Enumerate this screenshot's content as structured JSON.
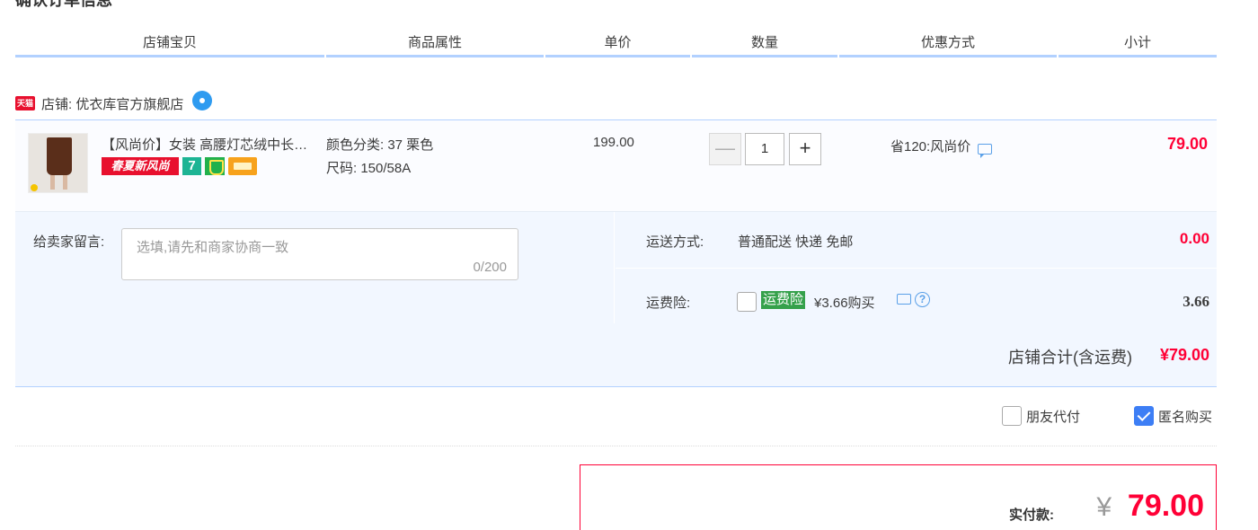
{
  "section_title": "确认订单信息",
  "headers": [
    "店铺宝贝",
    "商品属性",
    "单价",
    "数量",
    "优惠方式",
    "小计"
  ],
  "shop": {
    "badge": "天猫",
    "label": "店铺: 优衣库官方旗舰店"
  },
  "item": {
    "title": "【风尚价】女装 高腰灯芯绒中长款半身裙",
    "promo_tag": "春夏新风尚",
    "seven_tag": "7",
    "color_attr": "颜色分类: 37 栗色",
    "size_attr": "尺码: 150/58A",
    "unit_price": "199.00",
    "qty_minus": "—",
    "quantity": "1",
    "qty_plus": "+",
    "discount": "省120:风尚价",
    "subtotal": "79.00"
  },
  "message": {
    "label": "给卖家留言:",
    "placeholder": "选填,请先和商家协商一致",
    "counter": "0/200"
  },
  "shipping": {
    "label": "运送方式:",
    "value": "普通配送 快递 免邮",
    "fee": "0.00"
  },
  "insurance": {
    "label": "运费险:",
    "badge": "运费险",
    "text": "¥3.66购买",
    "help": "?",
    "fee": "3.66"
  },
  "shop_total": {
    "label": "店铺合计(含运费)",
    "value": "¥79.00"
  },
  "options": {
    "friend_pay": "朋友代付",
    "anonymous": "匿名购买",
    "anonymous_checked": true
  },
  "payment": {
    "label": "实付款:",
    "currency": "¥",
    "amount": "79.00"
  },
  "colors": {
    "accent_red": "#ff0036",
    "header_blue": "#b2d1ff",
    "panel_bg": "#f2f7ff"
  }
}
